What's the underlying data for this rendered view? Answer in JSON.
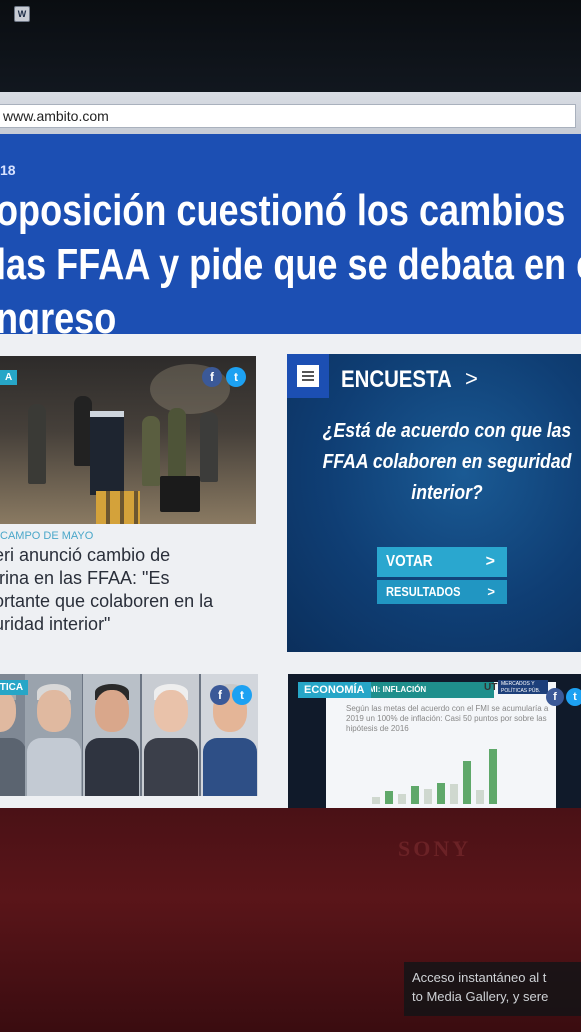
{
  "browser": {
    "url": "www.ambito.com"
  },
  "hero": {
    "kicker": "18",
    "title": "oposición cuestionó los cambios\nlas FFAA y pide que se debata en el\nngreso"
  },
  "news": {
    "tag": "A",
    "kicker": "CAMPO DE MAYO",
    "headline": "eri anunció cambio de\ntrina en las FFAA: \"Es\nortante que colaboren en la\nuridad interior\"",
    "share_facebook": "f",
    "share_twitter": "t"
  },
  "poll": {
    "title": "ENCUESTA",
    "chevron": ">",
    "question": "¿Está de acuerdo con que las\nFFAA colaboren en seguridad\ninterior?",
    "vote_label": "VOTAR",
    "results_label": "RESULTADOS",
    "arrow": ">"
  },
  "people_card": {
    "tag": "ITICA"
  },
  "economy": {
    "tag": "ECONOMÍA",
    "header": "FMI: INFLACIÓN",
    "logo": "UTDT",
    "sub": "MERCADOS Y POLÍTICAS PÚB.",
    "text": "Según las metas del acuerdo con el FMI se acumularía a 2019 un 100% de inflación: Casi 50 puntos por sobre las hipótesis de 2016",
    "bars": [
      0.1,
      0.18,
      0.14,
      0.26,
      0.22,
      0.3,
      0.28,
      0.62,
      0.2,
      0.78
    ]
  },
  "monitor": {
    "brand": "SONY",
    "toast": "Acceso instantáneo al t\nto Media Gallery, y sere"
  }
}
